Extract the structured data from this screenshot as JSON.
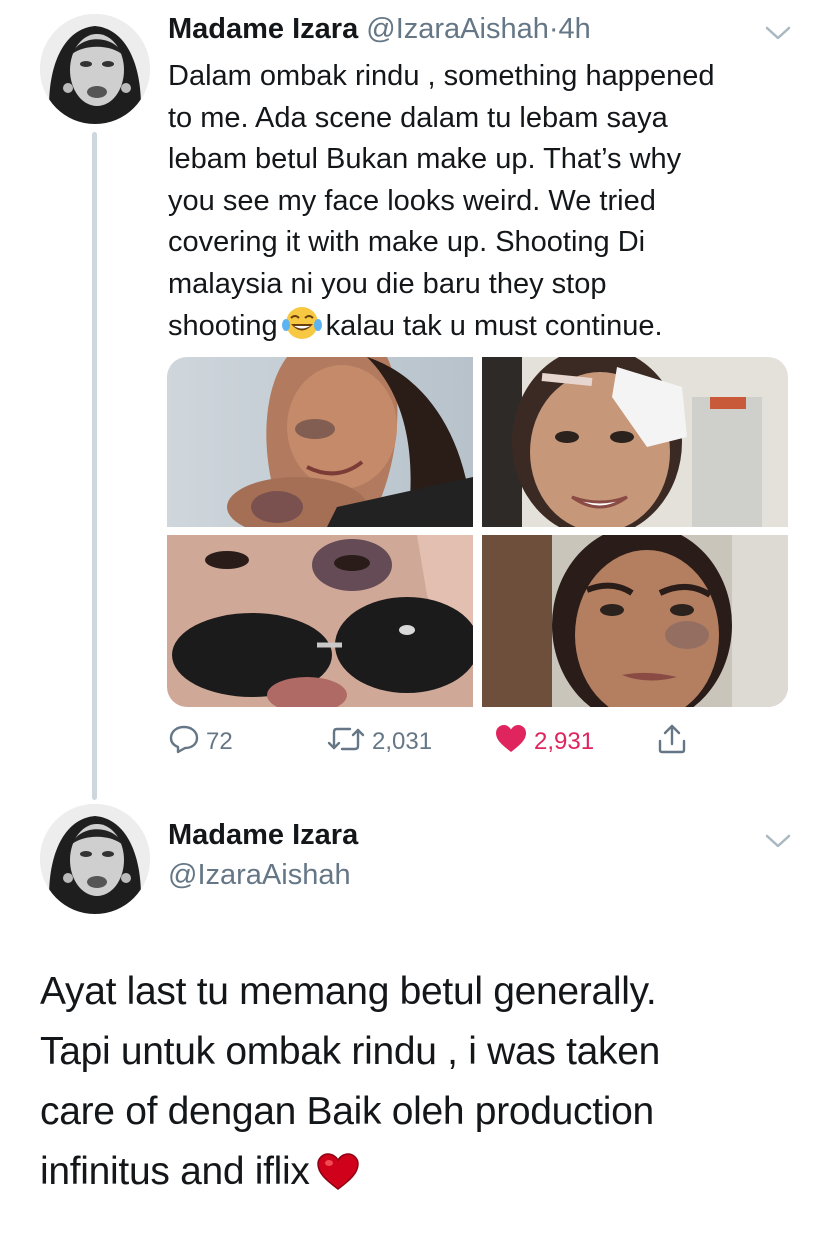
{
  "tweet1": {
    "author_name": "Madame Izara",
    "handle": "@IzaraAishah",
    "separator": "·",
    "time": "4h",
    "text_lines": [
      "Dalam ombak rindu , something happened",
      "to me. Ada scene dalam tu lebam saya",
      "lebam betul Bukan make up. That’s why",
      "you see my face looks weird. We tried",
      "covering it with make up. Shooting Di",
      "malaysia ni you die baru they stop"
    ],
    "last_line_before_emoji": "shooting",
    "emoji": "face-with-tears-of-joy",
    "last_line_after_emoji": "kalau tak u must continue.",
    "photos": [
      "photo-1",
      "photo-2",
      "photo-3",
      "photo-4"
    ],
    "actions": {
      "replies": "72",
      "retweets": "2,031",
      "likes": "2,931"
    }
  },
  "tweet2": {
    "author_name": "Madame Izara",
    "handle": "@IzaraAishah",
    "text_lines": [
      "Ayat last tu memang betul generally.",
      "Tapi untuk ombak rindu , i was taken",
      "care of dengan Baik oleh production"
    ],
    "last_line": "infinitus and iflix",
    "emoji": "red-heart"
  },
  "colors": {
    "text": "#14171a",
    "secondary": "#657786",
    "like": "#e0245e",
    "thread_line": "#cdd7de"
  }
}
